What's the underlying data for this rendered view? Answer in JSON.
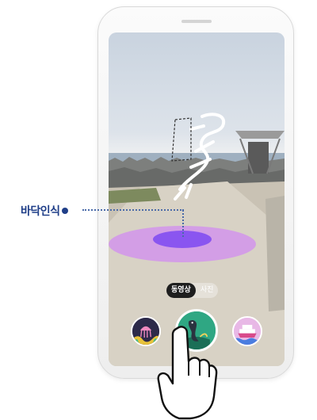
{
  "callout": {
    "label": "바닥인식",
    "color": "#1f3e88"
  },
  "mode_toggle": {
    "options": [
      "동영상",
      "사진"
    ],
    "selected": "동영상"
  },
  "content_buttons": [
    {
      "icon": "jellyfish-icon",
      "state": "default"
    },
    {
      "icon": "seal-icon",
      "state": "selected"
    },
    {
      "icon": "ship-icon",
      "state": "default"
    }
  ],
  "floor_marker": {
    "inner_color": "#8a55f0",
    "outer_color": "#d28cf0"
  },
  "gesture": {
    "icon": "tap-hand-icon"
  }
}
